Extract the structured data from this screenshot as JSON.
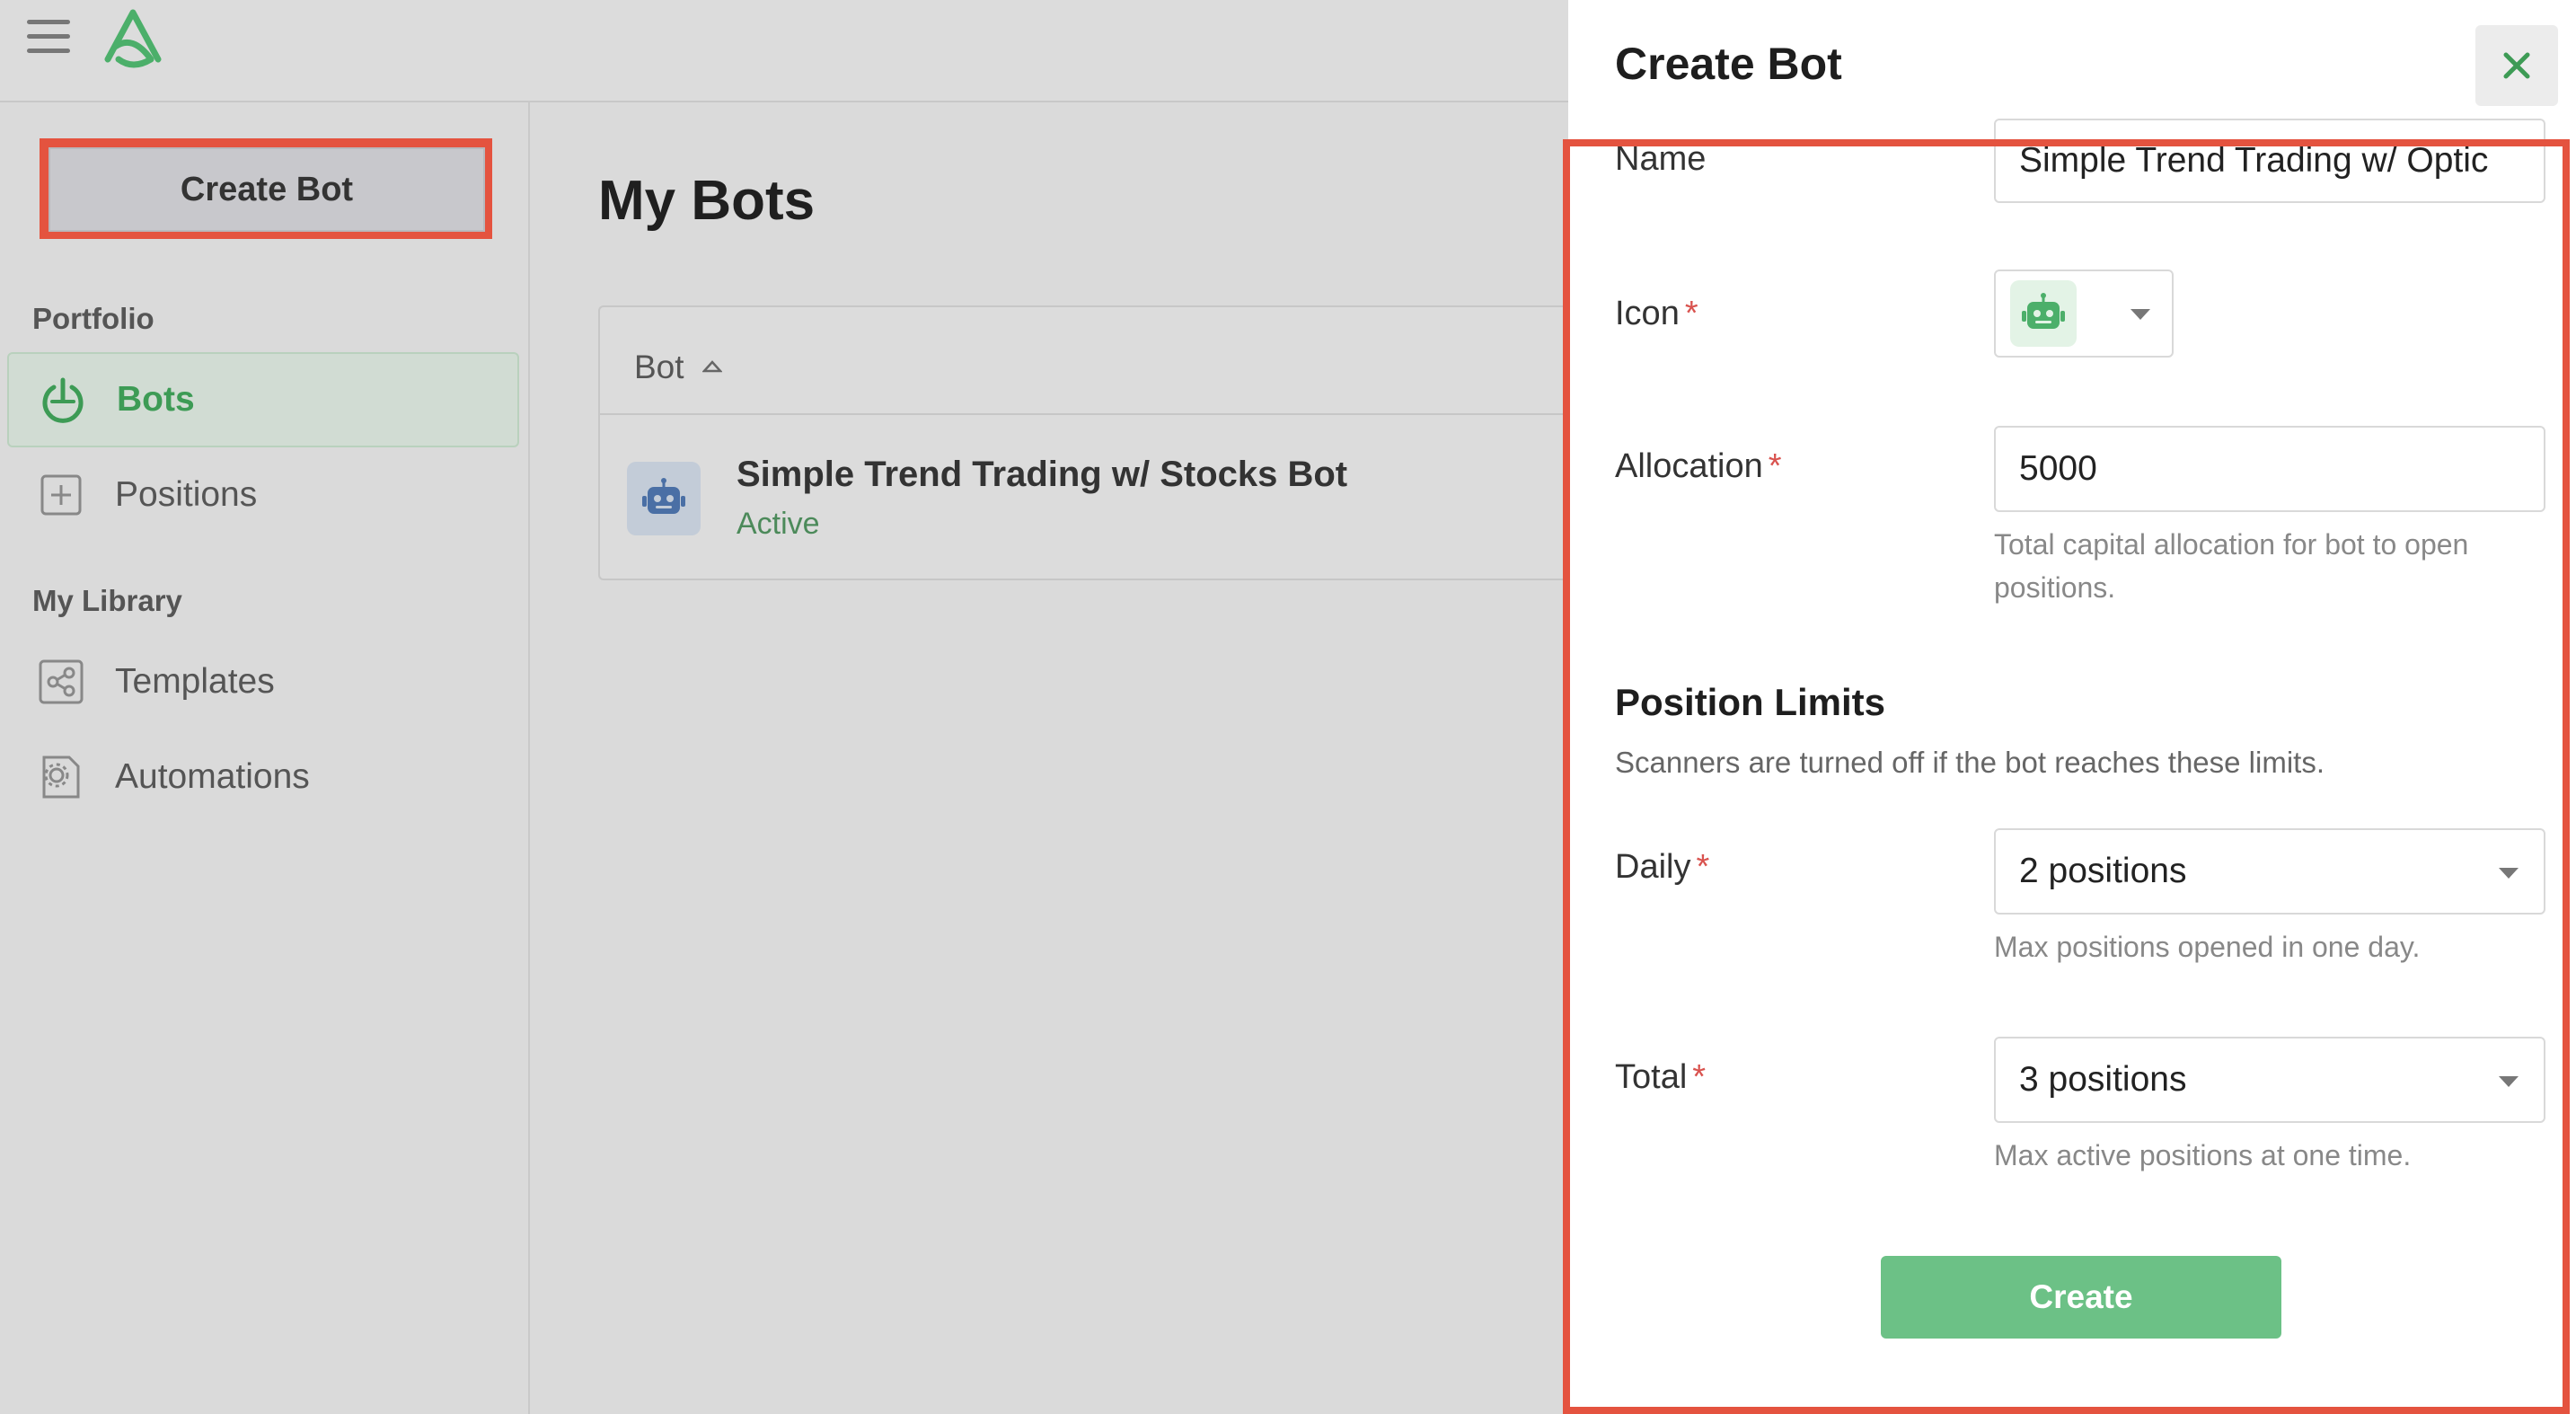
{
  "header": {
    "menu_icon": "hamburger-icon",
    "logo_icon": "app-logo"
  },
  "sidebar": {
    "create_button_label": "Create Bot",
    "sections": [
      {
        "label": "Portfolio",
        "items": [
          {
            "label": "Bots",
            "icon": "power-icon",
            "active": true
          },
          {
            "label": "Positions",
            "icon": "plus-square-icon",
            "active": false
          }
        ]
      },
      {
        "label": "My Library",
        "items": [
          {
            "label": "Templates",
            "icon": "share-icon",
            "active": false
          },
          {
            "label": "Automations",
            "icon": "gear-doc-icon",
            "active": false
          }
        ]
      }
    ]
  },
  "main": {
    "title": "My Bots",
    "table": {
      "column_header": "Bot",
      "rows": [
        {
          "name": "Simple Trend Trading w/ Stocks Bot",
          "status": "Active"
        }
      ]
    }
  },
  "panel": {
    "title": "Create Bot",
    "close_icon": "close-icon",
    "name_label": "Name",
    "name_value": "Simple Trend Trading w/ Optic",
    "icon_label": "Icon",
    "required_mark": "*",
    "allocation_label": "Allocation",
    "allocation_value": "5000",
    "allocation_help": "Total capital allocation for bot to open positions.",
    "position_limits_title": "Position Limits",
    "position_limits_desc": "Scanners are turned off if the bot reaches these limits.",
    "daily_label": "Daily",
    "daily_value": "2 positions",
    "daily_help": "Max positions opened in one day.",
    "total_label": "Total",
    "total_value": "3 positions",
    "total_help": "Max active positions at one time.",
    "submit_label": "Create"
  },
  "colors": {
    "accent_green": "#3d9b55",
    "button_green": "#6cc186",
    "highlight_red": "#e4533f",
    "required_red": "#d9534f"
  }
}
